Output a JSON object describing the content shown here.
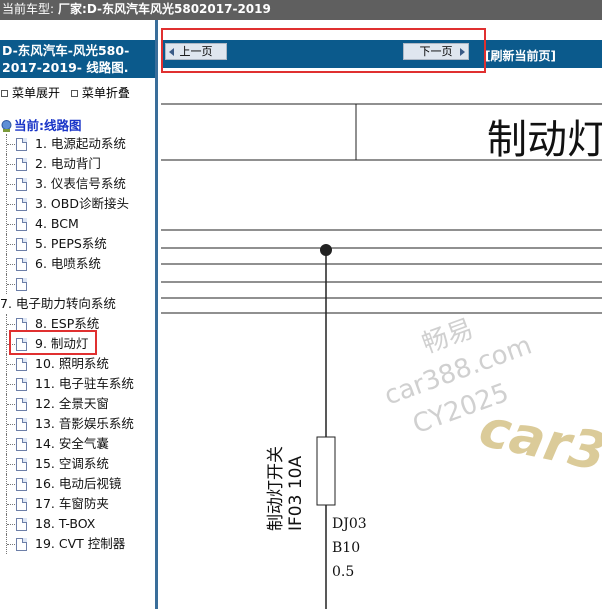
{
  "topbar": {
    "label": "当前车型:",
    "model": "厂家:D-东风汽车风光5802017-2019"
  },
  "sidebar": {
    "title": "D-东风汽车-风光580-2017-2019- 线路图.",
    "expand_label": "菜单展开",
    "collapse_label": "菜单折叠",
    "root_label": "当前:线路图",
    "items": [
      {
        "label": "1. 电源起动系统"
      },
      {
        "label": "2. 电动背门"
      },
      {
        "label": "3. 仪表信号系统"
      },
      {
        "label": "3. OBD诊断接头"
      },
      {
        "label": "4. BCM"
      },
      {
        "label": "5. PEPS系统"
      },
      {
        "label": "6. 电喷系统"
      },
      {
        "label": ""
      },
      {
        "label": "7. 电子助力转向系统",
        "group": true
      },
      {
        "label": "8. ESP系统"
      },
      {
        "label": "9. 制动灯",
        "selected": true
      },
      {
        "label": "10. 照明系统"
      },
      {
        "label": "11. 电子驻车系统"
      },
      {
        "label": "12. 全景天窗"
      },
      {
        "label": "13. 音影娱乐系统"
      },
      {
        "label": "14. 安全气囊"
      },
      {
        "label": "15. 空调系统"
      },
      {
        "label": "16. 电动后视镜"
      },
      {
        "label": "17. 车窗防夹"
      },
      {
        "label": "18. T-BOX"
      },
      {
        "label": "19. CVT 控制器"
      }
    ]
  },
  "navbar": {
    "prev_label": "上一页",
    "next_label": "下一页",
    "refresh_label": "[刷新当前页]"
  },
  "diagram": {
    "title": "制动灯",
    "switch_label": "制动灯开关",
    "switch_code": "IF03  10A",
    "wire_connector": "DJ03",
    "wire_color": "B10",
    "wire_size": "0.5",
    "watermark_1": "畅易",
    "watermark_2": "car388.com",
    "watermark_3": "CY2025",
    "watermark_logo": "car3"
  },
  "colors": {
    "topbar_bg": "#5f5f5f",
    "header_bg": "#0b5a8c",
    "tree_root": "#1a35c8",
    "highlight": "#e03030"
  }
}
